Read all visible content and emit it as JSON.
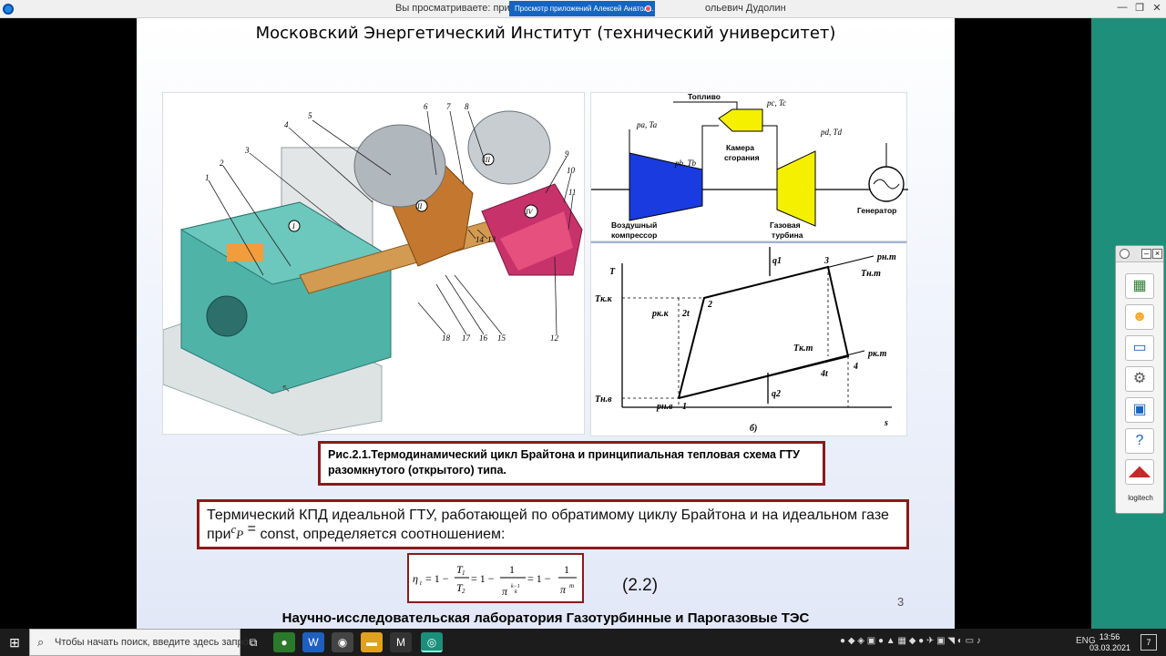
{
  "window": {
    "title_left": "Вы просматриваете: прилс",
    "title_right": "ольевич Дудолин",
    "share_banner": "Просмотр приложений Алексей Анатол...",
    "minimize": "—",
    "restore": "❐",
    "close": "✕"
  },
  "slide": {
    "title": "Московский Энергетический Институт (технический университет)",
    "caption": "Рис.2.1.Термодинамический цикл Брайтона и принципиальная тепловая схема ГТУ разомкнутого (открытого) типа.",
    "kpd_line1": "Термический КПД идеальной ГТУ, работающей по обратимому циклу Брайтона и на идеальном газе",
    "kpd_pre": "при",
    "kpd_cp": "c",
    "kpd_cp_sub": "P",
    "kpd_eq": " = ",
    "kpd_line2": "const, определяется соотношением:",
    "equation_number": "(2.2)",
    "page_number": "3",
    "footer": "Научно-исследовательская лаборатория Газотурбинные и Парогазовые ТЭС",
    "turbine_labels": [
      "1",
      "2",
      "3",
      "4",
      "5",
      "6",
      "7",
      "8",
      "9",
      "10",
      "11",
      "12",
      "13",
      "14",
      "15",
      "16",
      "17",
      "18"
    ],
    "turbine_roman": [
      "I",
      "II",
      "III",
      "IV"
    ],
    "scheme": {
      "fuel": "Топливо",
      "pa_ta": "pa, Ta",
      "pb_tb": "pb, Tb",
      "pc_tc": "pc, Tc",
      "pd_td": "pd, Td",
      "combustor_1": "Камера",
      "combustor_2": "сгорания",
      "compressor_1": "Воздушный",
      "compressor_2": "компрессор",
      "turbine_1": "Газовая",
      "turbine_2": "турбина",
      "generator": "Генератор"
    },
    "ts": {
      "t_axis": "T",
      "s_axis": "s",
      "q1": "q1",
      "q2": "q2",
      "p_nt": "pн.т",
      "t_nt": "Tн.т",
      "t_kk": "Tк.к",
      "p_kk": "pк.к",
      "t_kt": "Tк.т",
      "p_kt": "pк.т",
      "t_nv": "Tн.в",
      "p_nv": "pн.в",
      "pt1": "1",
      "pt2": "2",
      "pt2t": "2t",
      "pt3": "3",
      "pt4": "4",
      "pt4t": "4t",
      "label_b": "б)"
    }
  },
  "toolbox": {
    "brand": "logitech"
  },
  "taskbar": {
    "search_placeholder": "Чтобы начать поиск, введите здесь запрос",
    "language": "ENG",
    "time": "13:56",
    "date": "03.03.2021",
    "notifications": "7"
  },
  "colors": {
    "frame_border": "#8b1a1a",
    "compressor_blue": "#1a3be0",
    "turbine_yellow": "#f4f000",
    "teal_panel": "#1e8f7a"
  }
}
